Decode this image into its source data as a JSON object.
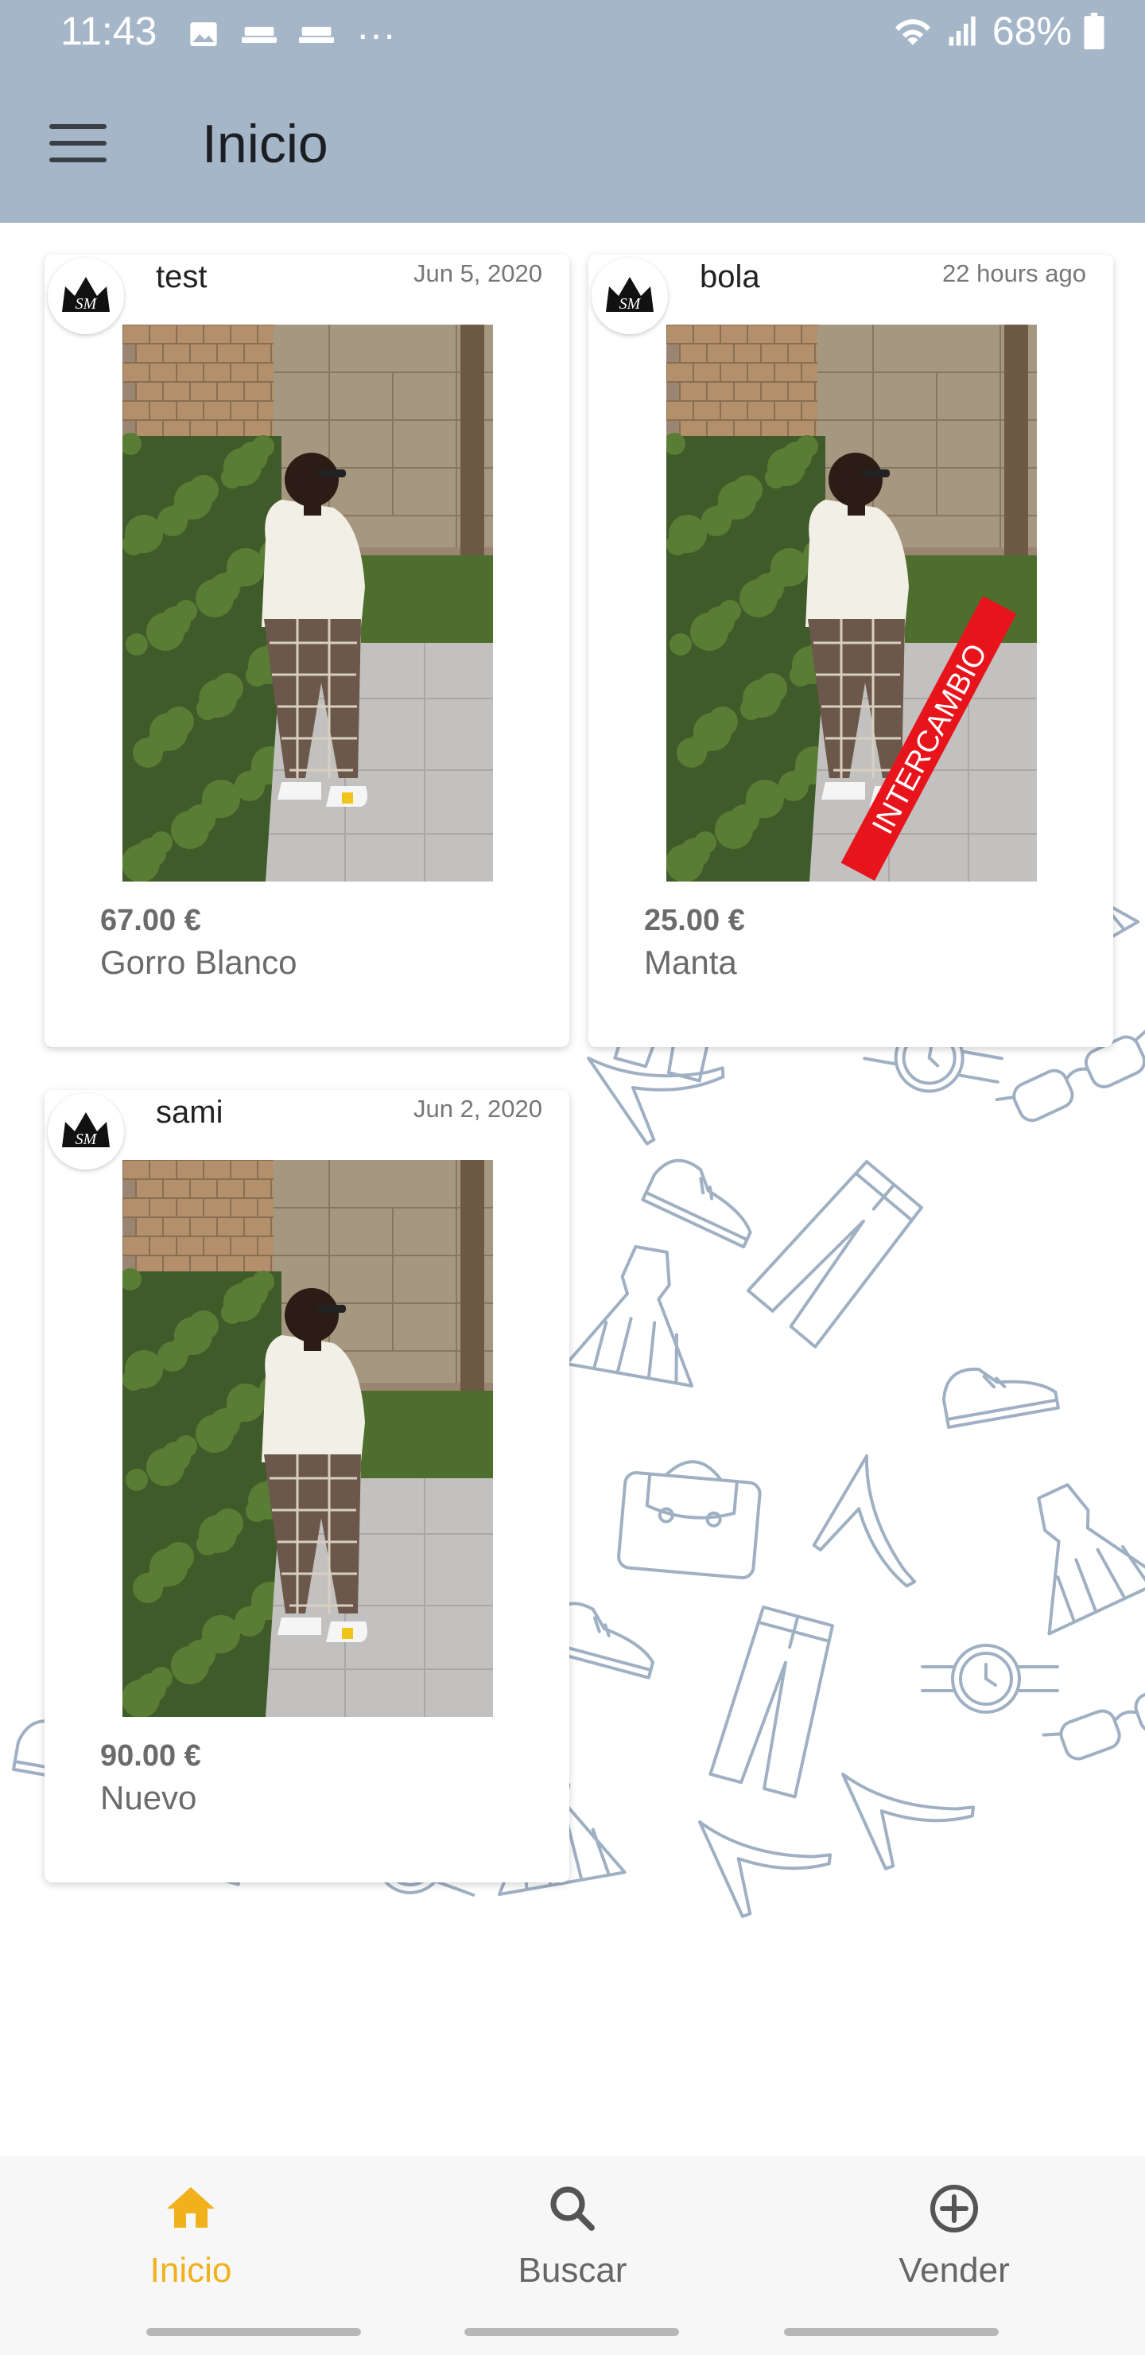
{
  "status_bar": {
    "time": "11:43",
    "battery": "68%",
    "more": "···",
    "icons": [
      "image-icon",
      "cast-icon",
      "cast-icon",
      "wifi-icon",
      "signal-icon",
      "battery-icon"
    ]
  },
  "app_bar": {
    "title": "Inicio",
    "menu_icon": "hamburger-menu-icon"
  },
  "colors": {
    "app_bar": "#a5b6c9",
    "accent": "#f0b11c",
    "pattern": "#9fb0c3"
  },
  "listings": [
    {
      "user": "test",
      "date": "Jun 5, 2020",
      "price": "67.00 €",
      "name": "Gorro Blanco",
      "badge": "",
      "avatar_text": "SM"
    },
    {
      "user": "bola",
      "date": "22 hours ago",
      "price": "25.00 €",
      "name": "Manta",
      "badge": "INTERCAMBIO",
      "avatar_text": "SM"
    },
    {
      "user": "sami",
      "date": "Jun 2, 2020",
      "price": "90.00 €",
      "name": "Nuevo",
      "badge": "",
      "avatar_text": "SM"
    }
  ],
  "bottom_nav": {
    "items": [
      {
        "label": "Inicio",
        "icon": "home-icon",
        "active": true
      },
      {
        "label": "Buscar",
        "icon": "search-icon",
        "active": false
      },
      {
        "label": "Vender",
        "icon": "add-circle-icon",
        "active": false
      }
    ]
  }
}
